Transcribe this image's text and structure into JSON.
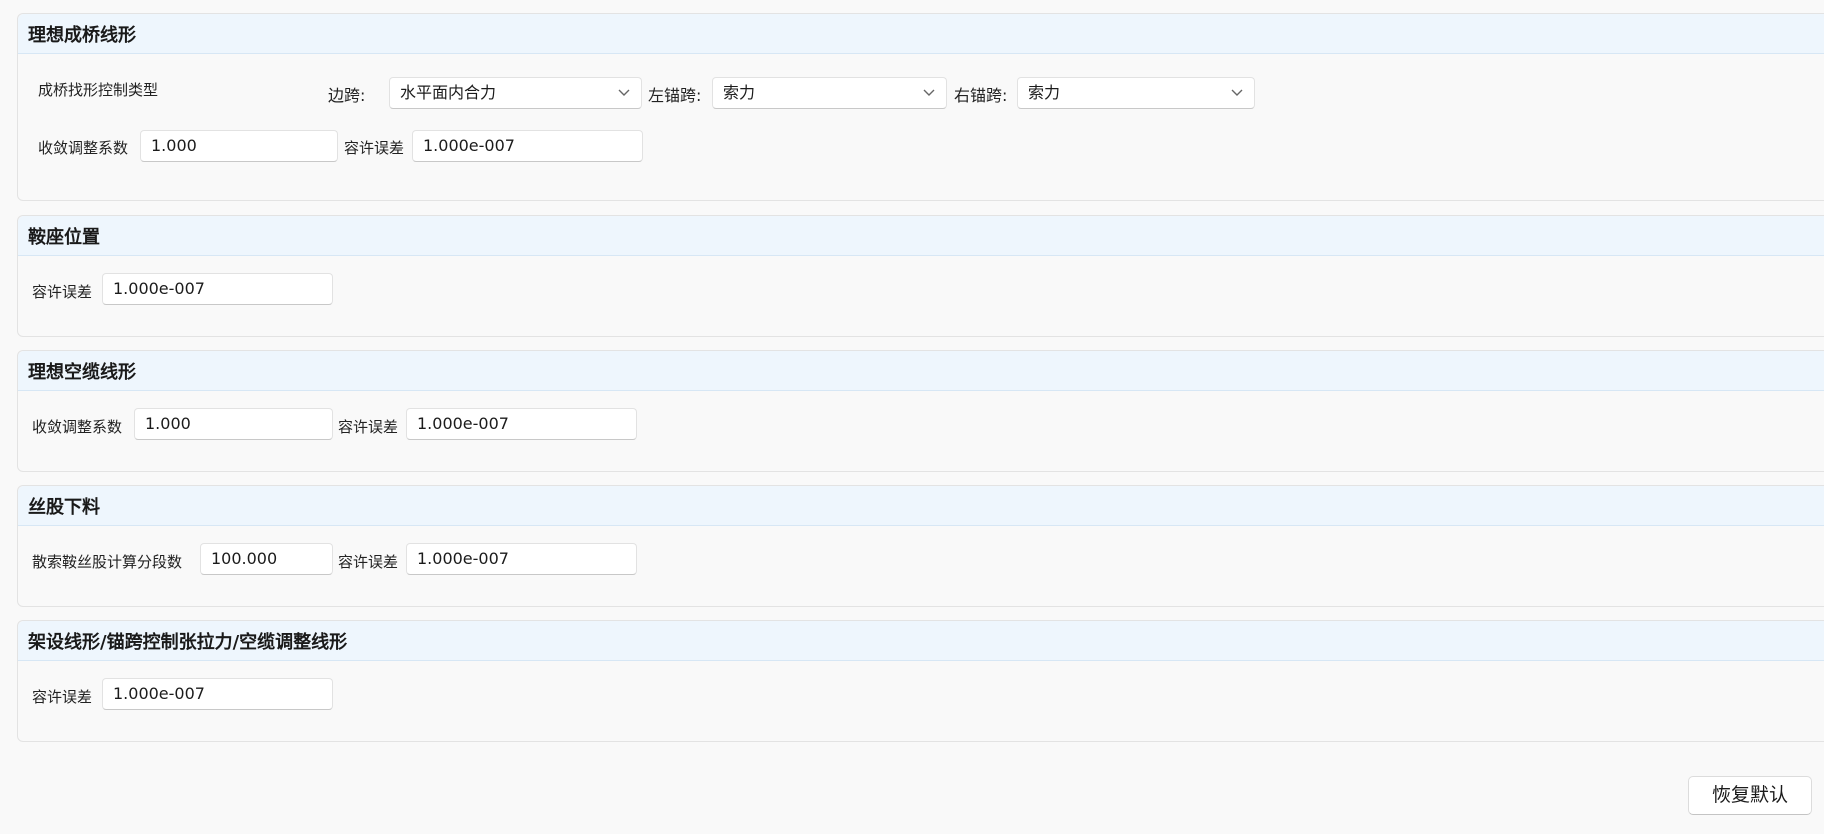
{
  "sections": {
    "ideal_bridge": {
      "title": "理想成桥线形",
      "control_type_label": "成桥找形控制类型",
      "side_span_label": "边跨:",
      "side_span_value": "水平面内合力",
      "left_anchor_label": "左锚跨:",
      "left_anchor_value": "索力",
      "right_anchor_label": "右锚跨:",
      "right_anchor_value": "索力",
      "convergence_label": "收敛调整系数",
      "convergence_value": "1.000",
      "tolerance_label": "容许误差",
      "tolerance_value": "1.000e-007"
    },
    "saddle": {
      "title": "鞍座位置",
      "tolerance_label": "容许误差",
      "tolerance_value": "1.000e-007"
    },
    "ideal_cable": {
      "title": "理想空缆线形",
      "convergence_label": "收敛调整系数",
      "convergence_value": "1.000",
      "tolerance_label": "容许误差",
      "tolerance_value": "1.000e-007"
    },
    "strand": {
      "title": "丝股下料",
      "segments_label": "散索鞍丝股计算分段数",
      "segments_value": "100.000",
      "tolerance_label": "容许误差",
      "tolerance_value": "1.000e-007"
    },
    "erection": {
      "title": "架设线形/锚跨控制张拉力/空缆调整线形",
      "tolerance_label": "容许误差",
      "tolerance_value": "1.000e-007"
    }
  },
  "footer": {
    "restore_default_label": "恢复默认"
  },
  "icons": {
    "dropdown": "chevron-down-icon"
  }
}
